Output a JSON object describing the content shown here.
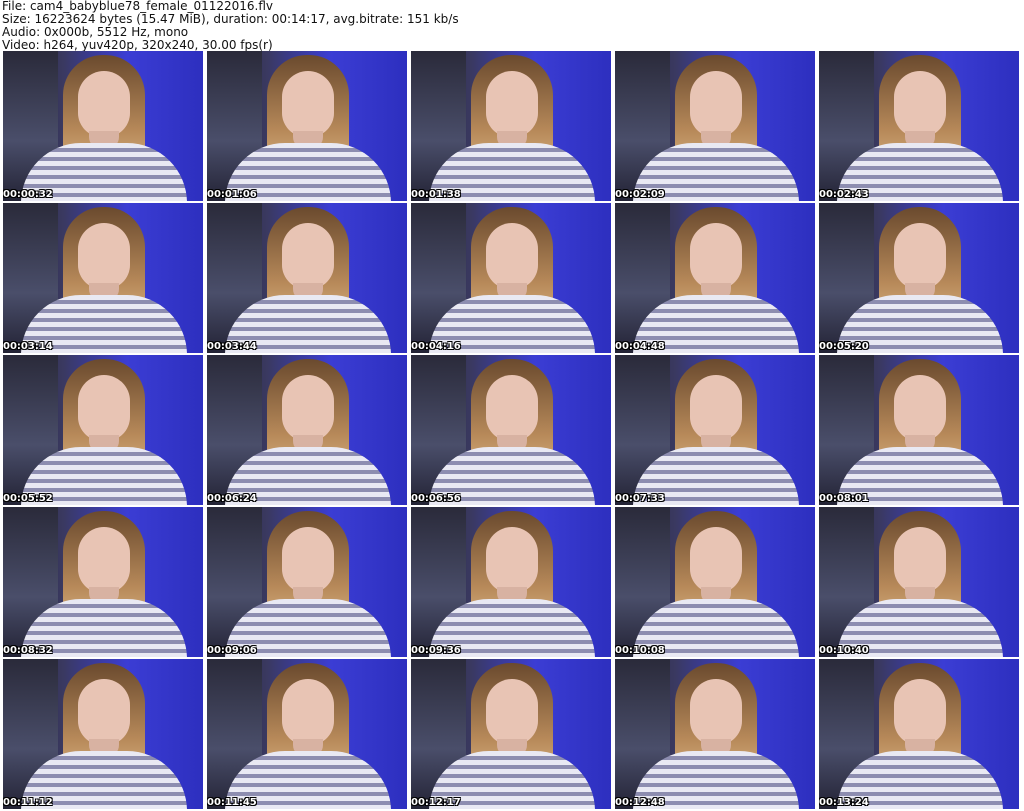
{
  "header": {
    "file": "File: cam4_babyblue78_female_01122016.flv",
    "size": "Size: 16223624 bytes (15.47 MiB), duration: 00:14:17, avg.bitrate: 151 kb/s",
    "audio": "Audio: 0x000b, 5512 Hz, mono",
    "video": "Video: h264, yuv420p, 320x240, 30.00 fps(r)"
  },
  "thumbnails": [
    "00:00:32",
    "00:01:06",
    "00:01:38",
    "00:02:09",
    "00:02:43",
    "00:03:14",
    "00:03:44",
    "00:04:16",
    "00:04:48",
    "00:05:20",
    "00:05:52",
    "00:06:24",
    "00:06:56",
    "00:07:33",
    "00:08:01",
    "00:08:32",
    "00:09:06",
    "00:09:36",
    "00:10:08",
    "00:10:40",
    "00:11:12",
    "00:11:45",
    "00:12:17",
    "00:12:48",
    "00:13:24"
  ]
}
